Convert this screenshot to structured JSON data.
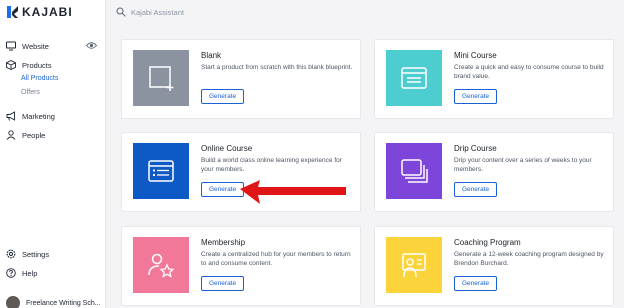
{
  "brand": {
    "name": "KAJABI"
  },
  "search": {
    "placeholder": "Kajabi Assistant"
  },
  "sidebar": {
    "website": "Website",
    "products": "Products",
    "all_products": "All Products",
    "offers": "Offers",
    "marketing": "Marketing",
    "people": "People",
    "settings": "Settings",
    "help": "Help",
    "user": "Freelance Writing Sch..."
  },
  "colors": {
    "accent": "#1b61d6",
    "blank": "#8b93a1",
    "mini_course": "#4dcdd0",
    "online_course": "#0d5ac7",
    "drip_course": "#7d45d9",
    "membership": "#f2789a",
    "coaching": "#fbd33a",
    "annotation_arrow": "#e01616"
  },
  "cards": [
    {
      "title": "Blank",
      "description": "Start a product from scratch with this blank blueprint.",
      "button": "Generate",
      "icon": "blank-square-plus-icon"
    },
    {
      "title": "Mini Course",
      "description": "Create a quick and easy to consume course to build brand value.",
      "button": "Generate",
      "icon": "list-window-icon"
    },
    {
      "title": "Online Course",
      "description": "Build a world class online learning experience for your members.",
      "button": "Generate",
      "icon": "course-window-icon"
    },
    {
      "title": "Drip Course",
      "description": "Drip your content over a series of weeks to your members.",
      "button": "Generate",
      "icon": "stacked-windows-icon"
    },
    {
      "title": "Membership",
      "description": "Create a centralized hub for your members to return to and consume content.",
      "button": "Generate",
      "icon": "person-star-icon"
    },
    {
      "title": "Coaching Program",
      "description": "Generate a 12-week coaching program designed by Brendon Burchard.",
      "button": "Generate",
      "icon": "presenter-board-icon"
    }
  ]
}
